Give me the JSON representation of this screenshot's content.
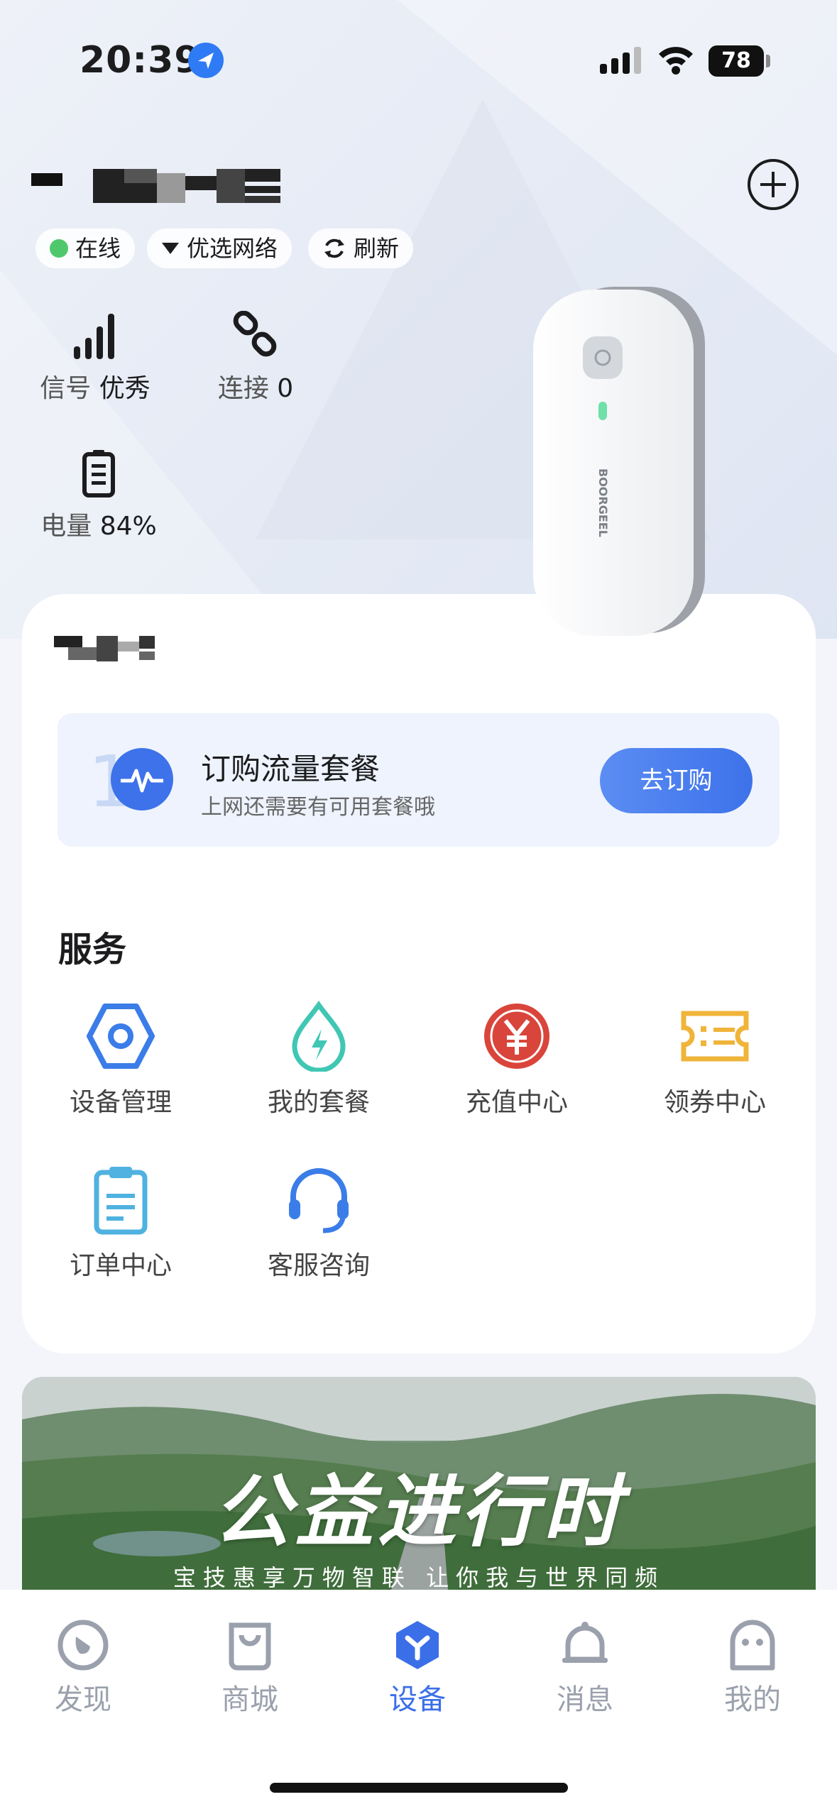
{
  "status_bar": {
    "time": "20:39",
    "battery": "78",
    "icons": [
      "location-arrow-icon",
      "cellular-signal-icon",
      "wifi-icon",
      "battery-icon"
    ]
  },
  "device": {
    "name_redacted": true,
    "brand": "BOORGEEL",
    "chips": [
      {
        "label": "在线",
        "icon": "green-dot-icon"
      },
      {
        "label": "优选网络",
        "icon": "caret-down-icon"
      },
      {
        "label": "刷新",
        "icon": "refresh-icon"
      }
    ],
    "stats": {
      "signal": {
        "label": "信号",
        "value": "优秀"
      },
      "connections": {
        "label": "连接",
        "value": "0"
      },
      "battery": {
        "label": "电量",
        "value": "84%"
      }
    }
  },
  "plan": {
    "title": "订购流量套餐",
    "subtitle": "上网还需要有可用套餐哦",
    "button": "去订购"
  },
  "services": {
    "title": "服务",
    "items": [
      {
        "label": "设备管理",
        "icon": "hexagon-settings-icon",
        "color": "#3b7de8"
      },
      {
        "label": "我的套餐",
        "icon": "drop-bolt-icon",
        "color": "#3fc7b4"
      },
      {
        "label": "充值中心",
        "icon": "yen-circle-icon",
        "color": "#d9453b"
      },
      {
        "label": "领券中心",
        "icon": "ticket-icon",
        "color": "#f0b43a"
      },
      {
        "label": "订单中心",
        "icon": "clipboard-icon",
        "color": "#4fb2e0"
      },
      {
        "label": "客服咨询",
        "icon": "headset-icon",
        "color": "#3b7de8"
      }
    ]
  },
  "banner": {
    "title": "公益进行时",
    "subtitle": "宝技惠享万物智联 让你我与世界同频"
  },
  "tabs": [
    {
      "label": "发现",
      "icon": "discover-icon",
      "active": false
    },
    {
      "label": "商城",
      "icon": "shopping-bag-icon",
      "active": false
    },
    {
      "label": "设备",
      "icon": "device-hex-icon",
      "active": true
    },
    {
      "label": "消息",
      "icon": "bell-icon",
      "active": false
    },
    {
      "label": "我的",
      "icon": "ghost-profile-icon",
      "active": false
    }
  ],
  "colors": {
    "accent": "#3b6fe8",
    "online": "#4fc76b"
  }
}
